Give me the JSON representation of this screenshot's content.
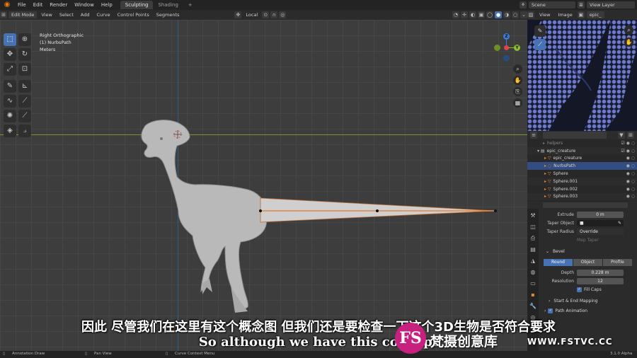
{
  "topbar": {
    "menus": [
      "File",
      "Edit",
      "Render",
      "Window",
      "Help"
    ],
    "workspace_tabs": [
      "Sculpting",
      "Shading"
    ],
    "active_tab": "Sculpting",
    "add_tab": "+",
    "scene": "Scene",
    "view_layer": "View Layer"
  },
  "viewport_header": {
    "mode": "Edit Mode",
    "menus": [
      "View",
      "Select",
      "Add",
      "Curve",
      "Control Points",
      "Segments"
    ],
    "transform_orientation": "Local"
  },
  "viewport": {
    "view_name": "Right Orthographic",
    "object_name": "(1) NurbsPath",
    "units": "Meters"
  },
  "gizmo": {
    "z": "Z",
    "x": "X",
    "y": "Y"
  },
  "image_editor": {
    "menus": [
      "View",
      "Image"
    ],
    "image_name": "epic_"
  },
  "outliner": {
    "rows": [
      {
        "name": "helpers",
        "level": 1,
        "dim": true
      },
      {
        "name": "epic_creature",
        "level": 1
      },
      {
        "name": "epic_creature",
        "level": 2
      },
      {
        "name": "NurbsPath",
        "level": 2,
        "selected": true
      },
      {
        "name": "Sphere",
        "level": 2
      },
      {
        "name": "Sphere.001",
        "level": 2
      },
      {
        "name": "Sphere.002",
        "level": 2
      },
      {
        "name": "Sphere.003",
        "level": 2
      }
    ]
  },
  "properties": {
    "extrude_label": "Extrude",
    "extrude_value": "0 m",
    "taper_object_label": "Taper Object",
    "taper_radius_label": "Taper Radius",
    "taper_radius_value": "Override",
    "map_taper": "Map Taper",
    "bevel_title": "Bevel",
    "bevel_modes": [
      "Round",
      "Object",
      "Profile"
    ],
    "active_bevel_mode": "Round",
    "depth_label": "Depth",
    "depth_value": "0.228 m",
    "resolution_label": "Resolution",
    "resolution_value": "12",
    "fill_caps": "Fill Caps",
    "start_end_mapping": "Start & End Mapping",
    "path_animation": "Path Animation"
  },
  "statusbar": {
    "left": "Annotation Draw",
    "mid": "Pan View",
    "right": "Curve Context Menu",
    "version": "3.1.0 Alpha"
  },
  "subtitles": {
    "chinese": "因此 尽管我们在这里有这个概念图 但我们还是要检查一下这个3D生物是否符合要求",
    "english": "So although we have this concept"
  },
  "watermark": {
    "logo": "FS",
    "brand": "梵摄创意库",
    "url": "WWW.FSTVC.CC"
  },
  "colors": {
    "accent": "#4772b3",
    "x_axis": "#7a9431",
    "z_axis": "#2f5e8e",
    "curve": "#e3874a",
    "mesh": "#b8b8b8",
    "watermark": "#c8207e"
  }
}
